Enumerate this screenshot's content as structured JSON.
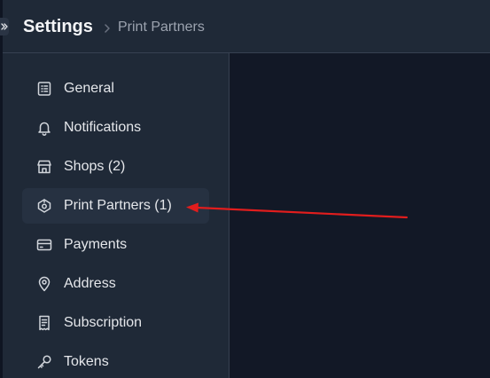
{
  "header": {
    "title": "Settings",
    "breadcrumb_current": "Print Partners"
  },
  "sidebar": {
    "items": [
      {
        "label": "General",
        "icon": "list-icon"
      },
      {
        "label": "Notifications",
        "icon": "bell-icon"
      },
      {
        "label": "Shops (2)",
        "icon": "store-icon"
      },
      {
        "label": "Print Partners (1)",
        "icon": "print-partner-icon",
        "active": true
      },
      {
        "label": "Payments",
        "icon": "credit-card-icon"
      },
      {
        "label": "Address",
        "icon": "map-pin-icon"
      },
      {
        "label": "Subscription",
        "icon": "receipt-icon"
      },
      {
        "label": "Tokens",
        "icon": "key-icon"
      }
    ]
  },
  "colors": {
    "background": "#121826",
    "panel": "#1f2937",
    "active_item": "#263141",
    "text_primary": "#e5e7eb",
    "text_muted": "#9ca3af",
    "annotation_arrow": "#e11d1d"
  }
}
